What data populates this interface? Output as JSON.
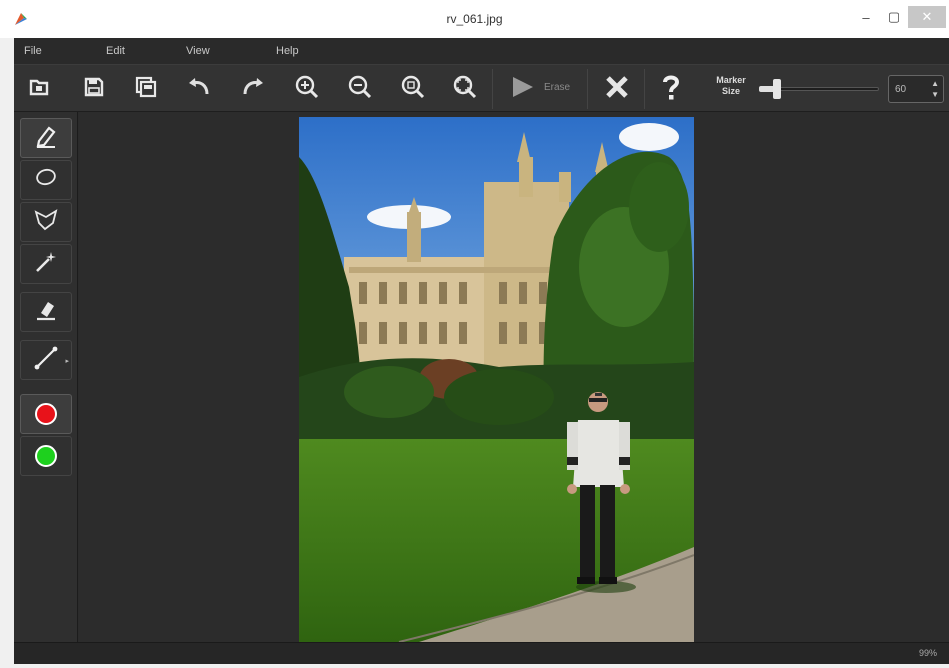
{
  "window": {
    "title": "rv_061.jpg",
    "minimize_glyph": "–",
    "maximize_glyph": "▢",
    "close_glyph": "✕"
  },
  "menu": {
    "items": [
      {
        "label": "File"
      },
      {
        "label": "Edit"
      },
      {
        "label": "View"
      },
      {
        "label": "Help"
      }
    ]
  },
  "toolbar": {
    "buttons": [
      {
        "icon": "open-icon"
      },
      {
        "icon": "save-icon"
      },
      {
        "icon": "save-as-icon"
      },
      {
        "icon": "undo-icon"
      },
      {
        "icon": "redo-icon"
      },
      {
        "icon": "zoom-in-icon"
      },
      {
        "icon": "zoom-out-icon"
      },
      {
        "icon": "zoom-actual-icon"
      },
      {
        "icon": "zoom-fit-icon"
      },
      {
        "icon": "play-icon"
      },
      {
        "icon": "clear-icon"
      },
      {
        "icon": "help-icon"
      }
    ],
    "erase_label": "Erase",
    "marker_size_label_line1": "Marker",
    "marker_size_label_line2": "Size",
    "marker_size_value": "60",
    "marker_size_fraction": 0.15
  },
  "tools": [
    {
      "name": "marker-tool",
      "icon": "pen-icon"
    },
    {
      "name": "lasso-tool",
      "icon": "lasso-icon"
    },
    {
      "name": "polygon-lasso-tool",
      "icon": "polygon-lasso-icon"
    },
    {
      "name": "magic-wand-tool",
      "icon": "magic-wand-icon"
    },
    {
      "name": "eraser-tool",
      "icon": "eraser-icon"
    },
    {
      "name": "line-tool",
      "icon": "line-icon"
    }
  ],
  "colors": {
    "red_marker": "#e8121a",
    "green_marker": "#1ed01e",
    "app_background": "#2b2b2b"
  },
  "status": {
    "zoom": "99%"
  }
}
